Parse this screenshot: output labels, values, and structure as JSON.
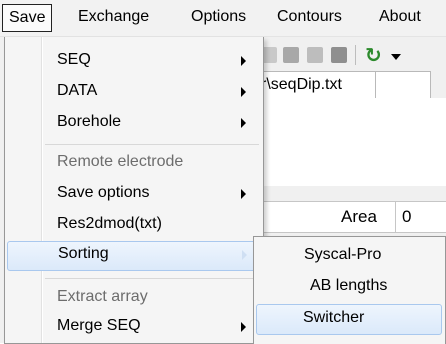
{
  "menubar": {
    "items": [
      "Save",
      "Exchange",
      "Options",
      "Contours",
      "About"
    ]
  },
  "background": {
    "path_text": "r\\seqDip.txt",
    "area_label": "Area",
    "area_value": "0"
  },
  "save_menu": {
    "items": [
      {
        "label": "SEQ",
        "submenu": true,
        "enabled": true
      },
      {
        "label": "DATA",
        "submenu": true,
        "enabled": true
      },
      {
        "label": "Borehole",
        "submenu": true,
        "enabled": true
      },
      {
        "label": "Remote electrode",
        "submenu": false,
        "enabled": false
      },
      {
        "label": "Save options",
        "submenu": true,
        "enabled": true
      },
      {
        "label": "Res2dmod(txt)",
        "submenu": false,
        "enabled": true
      },
      {
        "label": "Sorting",
        "submenu": true,
        "enabled": true,
        "highlighted": true
      },
      {
        "label": "Extract array",
        "submenu": false,
        "enabled": false
      },
      {
        "label": "Merge SEQ",
        "submenu": true,
        "enabled": true
      }
    ]
  },
  "sorting_submenu": {
    "items": [
      {
        "label": "Syscal-Pro"
      },
      {
        "label": "AB lengths"
      },
      {
        "label": "Switcher",
        "highlighted": true
      }
    ]
  },
  "colors": {
    "highlight": "#dbe9fa",
    "highlight_border": "#a9c8ee",
    "menu_bg": "#f5f5f5",
    "disabled_text": "#6d6d6d"
  }
}
